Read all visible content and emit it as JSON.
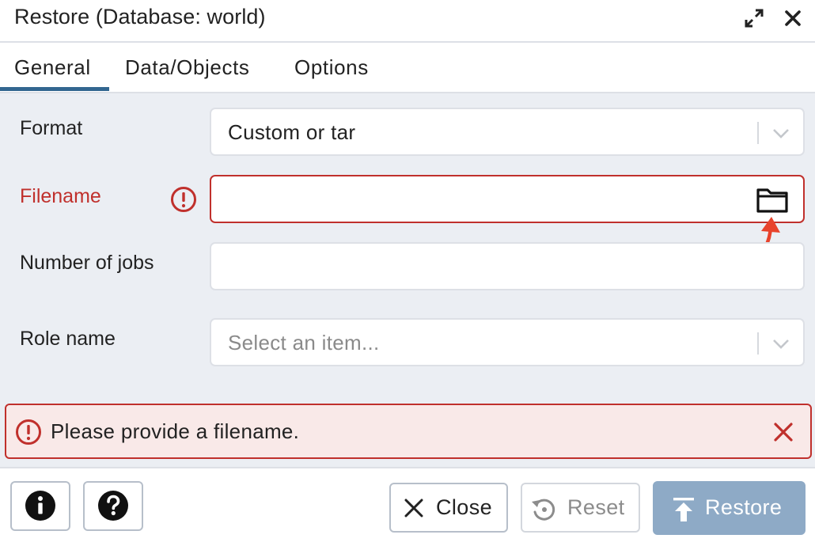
{
  "dialog": {
    "title": "Restore (Database: world)"
  },
  "tabs": [
    {
      "label": "General",
      "active": true
    },
    {
      "label": "Data/Objects",
      "active": false
    },
    {
      "label": "Options",
      "active": false
    }
  ],
  "form": {
    "format": {
      "label": "Format",
      "value": "Custom or tar"
    },
    "filename": {
      "label": "Filename",
      "value": "",
      "has_error": true
    },
    "jobs": {
      "label": "Number of jobs",
      "value": ""
    },
    "role": {
      "label": "Role name",
      "placeholder": "Select an item..."
    }
  },
  "alert": {
    "message": "Please provide a filename."
  },
  "footer": {
    "close_label": "Close",
    "reset_label": "Reset",
    "restore_label": "Restore"
  },
  "colors": {
    "error": "#c0302c",
    "accent": "#326690",
    "restore_button": "#8eaac6",
    "annotation_arrow": "#e8432c",
    "content_bg": "#ebeef3"
  }
}
